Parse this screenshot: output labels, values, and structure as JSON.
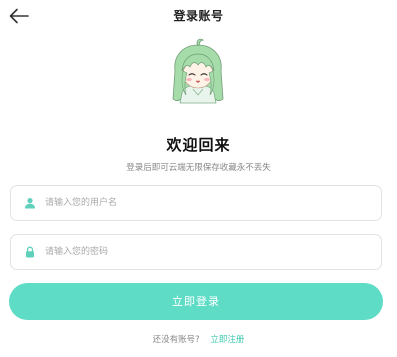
{
  "header": {
    "title": "登录账号",
    "back_icon": "arrow-left-icon"
  },
  "welcome": {
    "title": "欢迎回来",
    "subtitle": "登录后即可云端无限保存收藏永不丢失"
  },
  "form": {
    "username": {
      "placeholder": "请输入您的用户名",
      "value": "",
      "icon": "user-icon"
    },
    "password": {
      "placeholder": "请输入您的密码",
      "value": "",
      "icon": "lock-icon"
    },
    "login_label": "立即登录"
  },
  "register": {
    "prompt": "还没有账号?",
    "link_label": "立即注册"
  },
  "colors": {
    "accent": "#5fdcc6",
    "link": "#3fc8b0",
    "icon": "#5fd0bc",
    "hair": "#a6dcaa"
  }
}
